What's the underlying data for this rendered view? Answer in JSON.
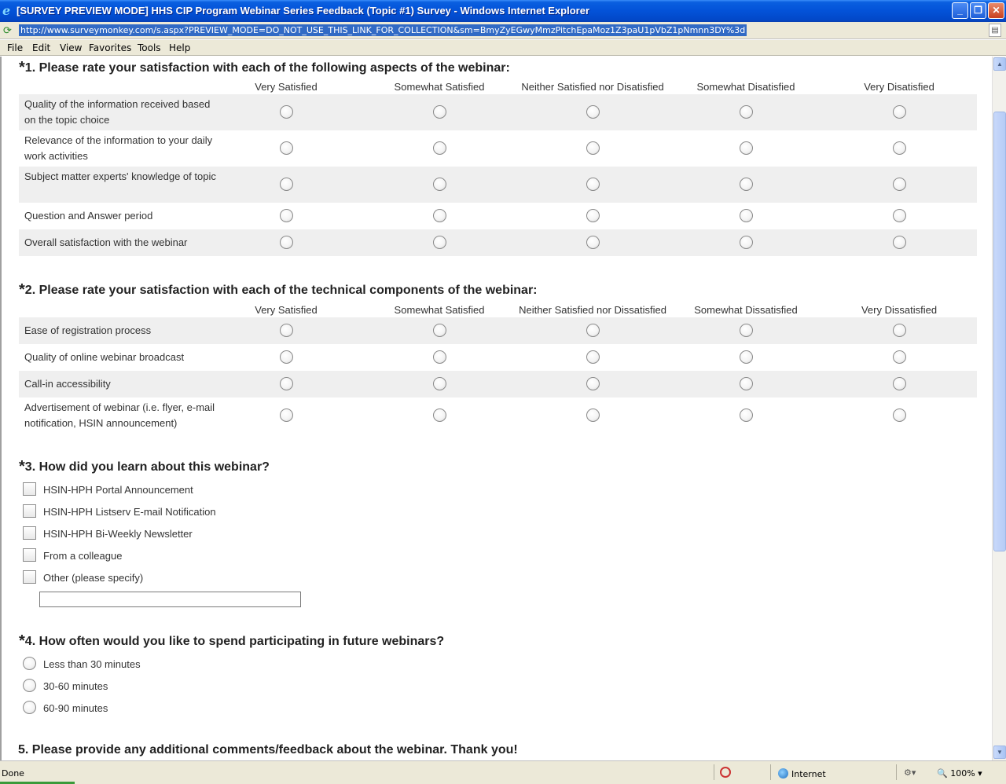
{
  "window": {
    "title": "[SURVEY PREVIEW MODE] HHS CIP Program Webinar Series Feedback (Topic #1) Survey - Windows Internet Explorer",
    "minimize": "_",
    "maximize": "❐",
    "close": "✕"
  },
  "address": {
    "url": "http://www.surveymonkey.com/s.aspx?PREVIEW_MODE=DO_NOT_USE_THIS_LINK_FOR_COLLECTION&sm=BmyZyEGwyMmzPitchEpaMoz1Z3paU1pVbZ1pNmnn3DY%3d"
  },
  "menu": [
    "File",
    "Edit",
    "View",
    "Favorites",
    "Tools",
    "Help"
  ],
  "survey": {
    "q1": {
      "title": "1. Please rate your satisfaction with each of the following aspects of the webinar:",
      "columns": [
        "Very Satisfied",
        "Somewhat Satisfied",
        "Neither Satisfied nor Disatisfied",
        "Somewhat Disatisfied",
        "Very Disatisfied"
      ],
      "rows": [
        "Quality of the information received based on the topic choice",
        "Relevance of the information to your daily work activities",
        "Subject matter experts' knowledge of topic",
        "Question and Answer period",
        "Overall satisfaction with the webinar"
      ]
    },
    "q2": {
      "title": "2. Please rate your satisfaction with each of the technical components of the webinar:",
      "columns": [
        "Very Satisfied",
        "Somewhat Satisfied",
        "Neither Satisfied nor Dissatisfied",
        "Somewhat Dissatisfied",
        "Very Dissatisfied"
      ],
      "rows": [
        "Ease of registration process",
        "Quality of online webinar broadcast",
        "Call-in accessibility",
        "Advertisement of webinar (i.e. flyer, e-mail notification, HSIN announcement)"
      ]
    },
    "q3": {
      "title": "3. How did you learn about this webinar?",
      "options": [
        "HSIN-HPH Portal Announcement",
        "HSIN-HPH Listserv E-mail Notification",
        "HSIN-HPH Bi-Weekly Newsletter",
        "From a colleague",
        "Other (please specify)"
      ],
      "other_value": ""
    },
    "q4": {
      "title": "4. How often would you like to spend participating in future webinars?",
      "options": [
        "Less than 30 minutes",
        "30-60 minutes",
        "60-90 minutes"
      ]
    },
    "q5": {
      "title": "5. Please provide any additional comments/feedback about the webinar. Thank you!"
    },
    "required_marker": "*"
  },
  "status": {
    "text": "Done",
    "zone": "Internet",
    "zoom": "100%"
  }
}
